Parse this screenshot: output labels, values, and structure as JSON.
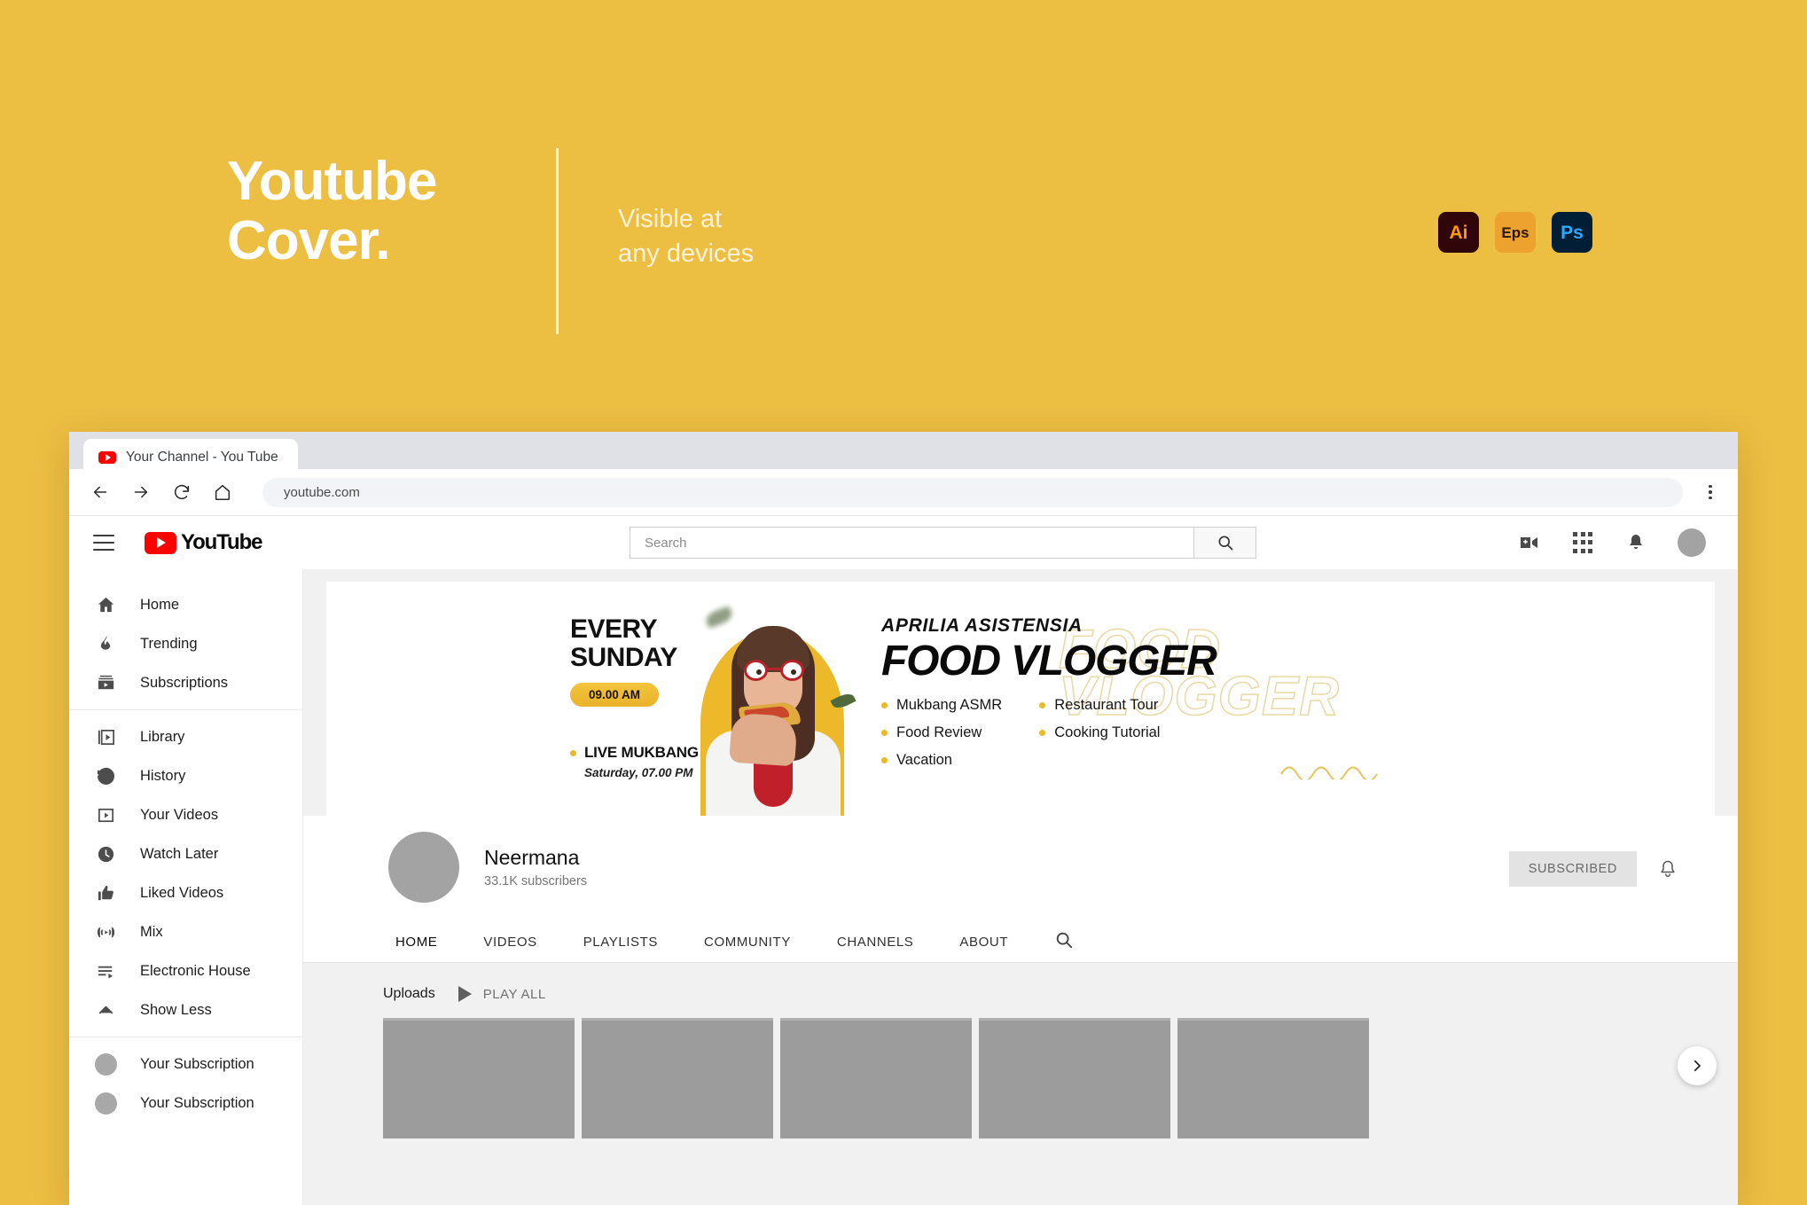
{
  "promo": {
    "title_line1": "Youtube",
    "title_line2": "Cover.",
    "subtitle_line1": "Visible at",
    "subtitle_line2": "any devices",
    "badges": [
      {
        "name": "illustrator-badge",
        "label": "Ai",
        "bg": "#31060b",
        "fg": "#ff9a00"
      },
      {
        "name": "eps-badge",
        "label": "Eps",
        "bg": "#eda12f",
        "fg": "#2c1604"
      },
      {
        "name": "photoshop-badge",
        "label": "Ps",
        "bg": "#001e36",
        "fg": "#31a8ff"
      }
    ],
    "background_color": "#ecbe42"
  },
  "browser": {
    "tab_title": "Your Channel - You Tube",
    "url": "youtube.com",
    "nav": {
      "back": "back-arrow",
      "forward": "forward-arrow",
      "reload": "reload",
      "home": "home"
    },
    "menu": "kebab-menu"
  },
  "youtube": {
    "header": {
      "logo_text": "YouTube",
      "search_placeholder": "Search",
      "search_value": "",
      "icons": [
        "create-video-icon",
        "apps-grid-icon",
        "notifications-bell-icon",
        "account-avatar"
      ]
    },
    "sidebar": {
      "group1": [
        {
          "label": "Home",
          "icon": "home-icon"
        },
        {
          "label": "Trending",
          "icon": "flame-icon"
        },
        {
          "label": "Subscriptions",
          "icon": "subscriptions-icon"
        }
      ],
      "group2": [
        {
          "label": "Library",
          "icon": "library-icon"
        },
        {
          "label": "History",
          "icon": "history-icon"
        },
        {
          "label": "Your Videos",
          "icon": "your-videos-icon"
        },
        {
          "label": "Watch Later",
          "icon": "clock-icon"
        },
        {
          "label": "Liked Videos",
          "icon": "thumbs-up-icon"
        },
        {
          "label": "Mix",
          "icon": "mix-icon"
        },
        {
          "label": "Electronic House",
          "icon": "playlist-icon"
        },
        {
          "label": "Show Less",
          "icon": "chevron-up-icon"
        }
      ],
      "subscriptions": [
        {
          "label": "Your Subscription"
        },
        {
          "label": "Your Subscription"
        }
      ]
    },
    "banner": {
      "every": "EVERY\nSUNDAY",
      "every_line1": "EVERY",
      "every_line2": "SUNDAY",
      "time_pill": "09.00 AM",
      "live_label": "LIVE MUKBANG",
      "live_sub": "Saturday, 07.00 PM",
      "channel_name": "APRILIA ASISTENSIA",
      "headline": "FOOD VLOGGER",
      "ghost_line1": "FOOD",
      "ghost_line2": "VLOGGER",
      "tags_col1": [
        "Mukbang ASMR",
        "Food Review",
        "Vacation"
      ],
      "tags_col2": [
        "Restaurant Tour",
        "Cooking Tutorial"
      ],
      "accent_color": "#e8b928"
    },
    "channel": {
      "name": "Neermana",
      "subscribers": "33.1K subscribers",
      "subscribe_button": "SUBSCRIBED",
      "bell": "notification-bell-icon",
      "tabs": [
        "HOME",
        "VIDEOS",
        "PLAYLISTS",
        "COMMUNITY",
        "CHANNELS",
        "ABOUT"
      ],
      "tab_search": "search-icon"
    },
    "uploads": {
      "section_label": "Uploads",
      "play_all": "PLAY ALL",
      "thumbnail_count": 5,
      "next_arrow": "chevron-right-icon"
    }
  }
}
